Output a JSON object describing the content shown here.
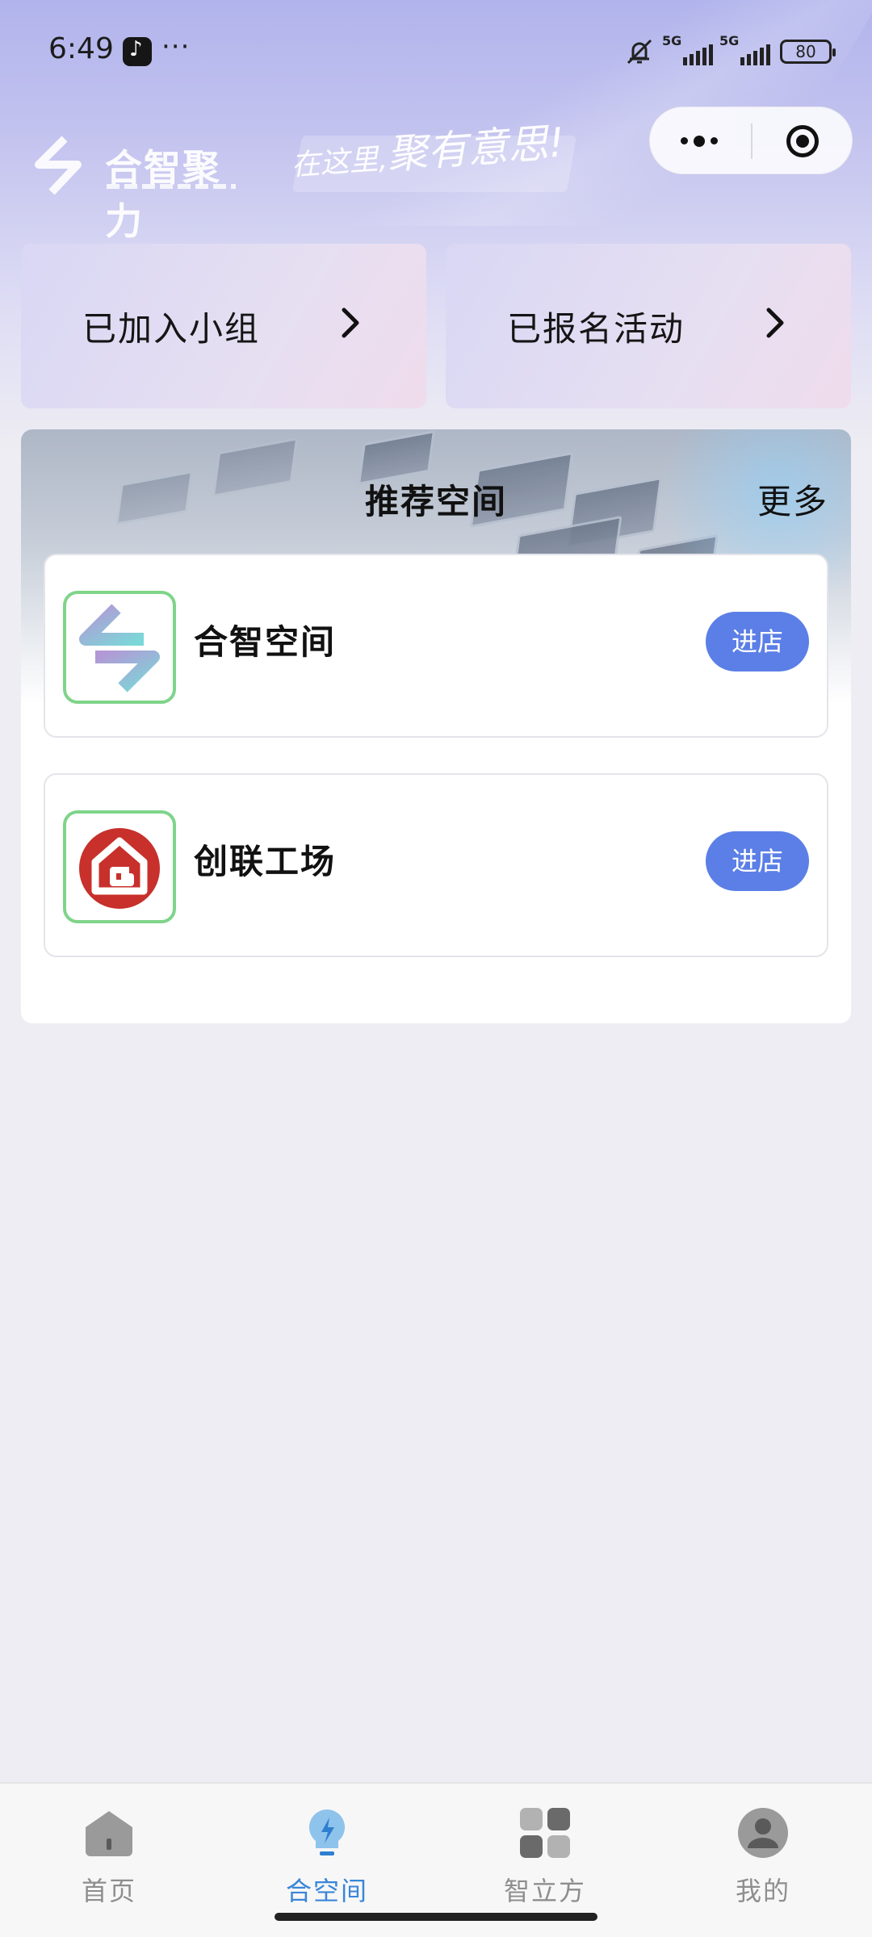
{
  "status_bar": {
    "time": "6:49",
    "more": "···",
    "network_1": "5G",
    "network_2": "5G",
    "battery": "80"
  },
  "header": {
    "brand_name": "合智聚力",
    "slogan_prefix": "在这里,",
    "slogan_main": "聚有意思!"
  },
  "quick_links": [
    {
      "label": "已加入小组"
    },
    {
      "label": "已报名活动"
    }
  ],
  "recommended": {
    "title": "推荐空间",
    "more": "更多",
    "spaces": [
      {
        "name": "合智空间",
        "button": "进店",
        "logo": "hezhi-logo"
      },
      {
        "name": "创联工场",
        "button": "进店",
        "logo": "chuanglian-logo"
      }
    ]
  },
  "tabbar": {
    "items": [
      {
        "label": "首页",
        "icon": "home-icon",
        "active": false
      },
      {
        "label": "合空间",
        "icon": "bulb-icon",
        "active": true
      },
      {
        "label": "智立方",
        "icon": "grid-icon",
        "active": false
      },
      {
        "label": "我的",
        "icon": "profile-icon",
        "active": false
      }
    ]
  },
  "colors": {
    "accent": "#5b7fe6",
    "tab_active": "#3a86d8",
    "logo_border": "#7fd48a",
    "chuanglian_red": "#c8302b"
  }
}
